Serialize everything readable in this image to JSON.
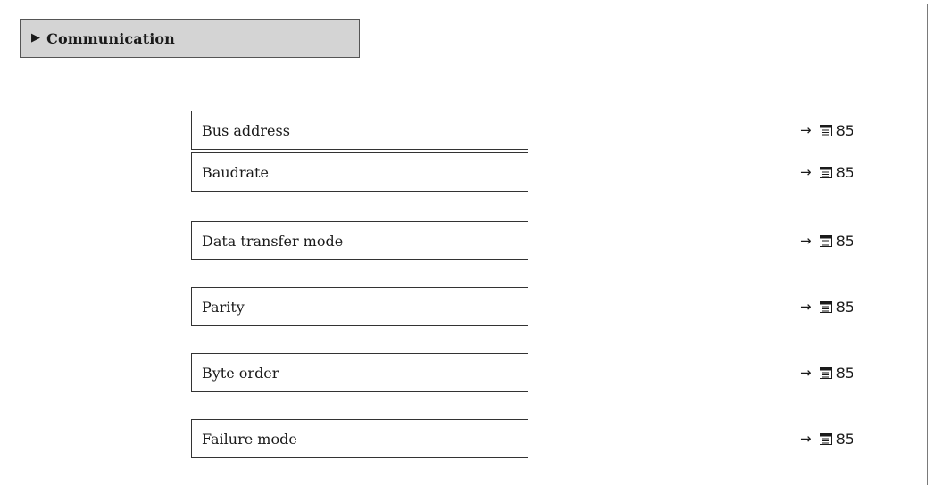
{
  "menu": {
    "title": "Communication",
    "marker": "▶"
  },
  "parameters": [
    {
      "label": "Bus address",
      "ref_arrow": "→",
      "ref_icon": "book-icon",
      "ref_page": "85"
    },
    {
      "label": "Baudrate",
      "ref_arrow": "→",
      "ref_icon": "book-icon",
      "ref_page": "85"
    },
    {
      "label": "Data transfer mode",
      "ref_arrow": "→",
      "ref_icon": "book-icon",
      "ref_page": "85"
    },
    {
      "label": "Parity",
      "ref_arrow": "→",
      "ref_icon": "book-icon",
      "ref_page": "85"
    },
    {
      "label": "Byte order",
      "ref_arrow": "→",
      "ref_icon": "book-icon",
      "ref_page": "85"
    },
    {
      "label": "Failure mode",
      "ref_arrow": "→",
      "ref_icon": "book-icon",
      "ref_page": "85"
    }
  ],
  "colors": {
    "header_bg": "#d4d4d4",
    "border": "#333333",
    "text": "#1a1a1a"
  }
}
